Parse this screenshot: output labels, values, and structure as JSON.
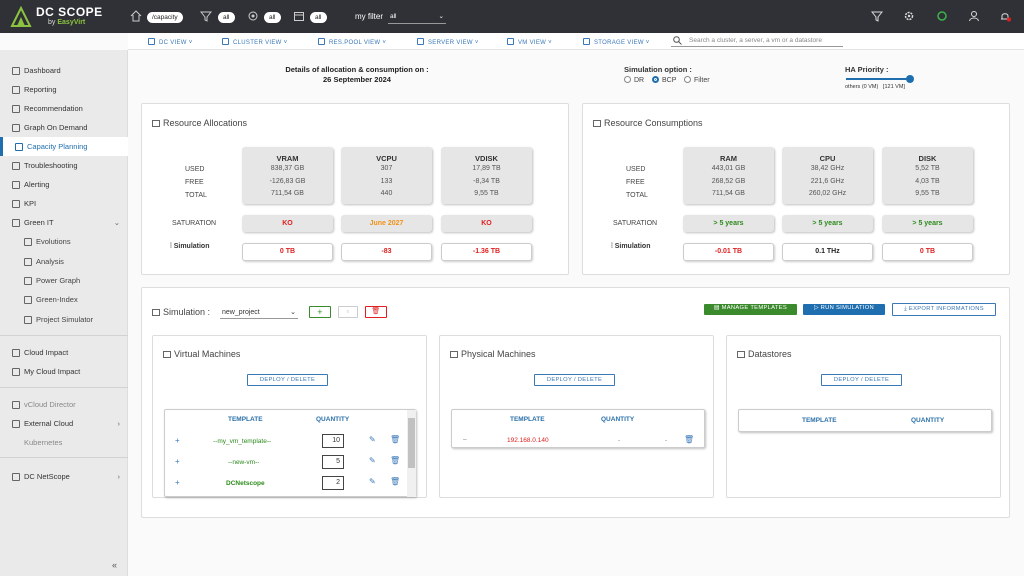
{
  "app": {
    "brand": "DC SCOPE",
    "brand_by": "by",
    "brand_sub": "EasyVirt"
  },
  "topbar": {
    "path": "/capacity",
    "filters": [
      "all",
      "all",
      "all"
    ],
    "my_filter_label": "my filter",
    "my_filter_value": "all"
  },
  "nav": [
    {
      "label": "DC VIEW ˅"
    },
    {
      "label": "CLUSTER VIEW ˅"
    },
    {
      "label": "RES.POOL VIEW ˅"
    },
    {
      "label": "SERVER VIEW ˅"
    },
    {
      "label": "VM VIEW ˅"
    },
    {
      "label": "STORAGE VIEW ˅"
    }
  ],
  "search": {
    "placeholder": "Search a cluster, a server, a vm or a datastore"
  },
  "sidebar": [
    {
      "label": "Dashboard"
    },
    {
      "label": "Reporting"
    },
    {
      "label": "Recommendation"
    },
    {
      "label": "Graph On Demand"
    },
    {
      "label": "Capacity Planning"
    },
    {
      "label": "Troubleshooting"
    },
    {
      "label": "Alerting"
    },
    {
      "label": "KPI"
    },
    {
      "label": "Green IT"
    },
    {
      "label": "Evolutions"
    },
    {
      "label": "Analysis"
    },
    {
      "label": "Power Graph"
    },
    {
      "label": "Green-Index"
    },
    {
      "label": "Project Simulator"
    },
    {
      "label": "Cloud Impact"
    },
    {
      "label": "My Cloud Impact"
    },
    {
      "label": "vCloud Director"
    },
    {
      "label": "External Cloud"
    },
    {
      "label": "Kubernetes"
    },
    {
      "label": "DC NetScope"
    }
  ],
  "header": {
    "details_line1": "Details of allocation & consumption on :",
    "details_date": "26 September 2024",
    "sim_option_label": "Simulation option :",
    "options": [
      "DR",
      "BCP",
      "Filter"
    ],
    "selected_option": "BCP",
    "ha_label": "HA Priority :",
    "ha_min": "others (0 VM)",
    "ha_max": "[121 VM]",
    "ha_level": 1.0
  },
  "row_labels": {
    "used": "USED",
    "free": "FREE",
    "total": "TOTAL",
    "saturation": "SATURATION",
    "simulation": "Simulation"
  },
  "allocations": {
    "title": "Resource Allocations",
    "metrics": [
      {
        "name": "VRAM",
        "used": "838,37 GB",
        "free": "-126,83 GB",
        "total": "711,54 GB",
        "saturation": "KO",
        "sat_color": "red",
        "simulation": "0 TB",
        "sim_color": "red"
      },
      {
        "name": "VCPU",
        "used": "307",
        "free": "133",
        "total": "440",
        "saturation": "June 2027",
        "sat_color": "orange",
        "simulation": "-83",
        "sim_color": "red"
      },
      {
        "name": "VDISK",
        "used": "17,89 TB",
        "free": "-8,34 TB",
        "total": "9,55 TB",
        "saturation": "KO",
        "sat_color": "red",
        "simulation": "-1.36 TB",
        "sim_color": "red"
      }
    ]
  },
  "consumptions": {
    "title": "Resource Consumptions",
    "metrics": [
      {
        "name": "RAM",
        "used": "443,01 GB",
        "free": "268,52 GB",
        "total": "711,54 GB",
        "saturation": "> 5 years",
        "sat_color": "green",
        "simulation": "-0.01 TB",
        "sim_color": "red"
      },
      {
        "name": "CPU",
        "used": "38,42 GHz",
        "free": "221,6 GHz",
        "total": "260,02 GHz",
        "saturation": "> 5 years",
        "sat_color": "green",
        "simulation": "0.1 THz",
        "sim_color": "dark"
      },
      {
        "name": "DISK",
        "used": "5,52 TB",
        "free": "4,03 TB",
        "total": "9,55 TB",
        "saturation": "> 5 years",
        "sat_color": "green",
        "simulation": "0 TB",
        "sim_color": "red"
      }
    ]
  },
  "simulation": {
    "label": "Simulation :",
    "project": "new_project",
    "manage_templates": "MANAGE TEMPLATES",
    "run": "RUN SIMULATION",
    "export": "EXPORT INFORMATIONS"
  },
  "vm": {
    "title": "Virtual Machines",
    "deploy": "DEPLOY / DELETE",
    "col_template": "TEMPLATE",
    "col_quantity": "QUANTITY",
    "rows": [
      {
        "name": "--my_vm_template--",
        "qty": "10"
      },
      {
        "name": "--new-vm--",
        "qty": "5"
      },
      {
        "name": "DCNetscope",
        "qty": "2"
      }
    ]
  },
  "pm": {
    "title": "Physical Machines",
    "deploy": "DEPLOY / DELETE",
    "col_template": "TEMPLATE",
    "col_quantity": "QUANTITY",
    "rows": [
      {
        "dash": "–",
        "name": "192.168.0.140",
        "qty": "-",
        "extra": "-"
      }
    ]
  },
  "ds": {
    "title": "Datastores",
    "deploy": "DEPLOY / DELETE",
    "col_template": "TEMPLATE",
    "col_quantity": "QUANTITY"
  },
  "colors": {
    "topbar": "#2f3136",
    "accent": "#1f6fb0",
    "green_btn": "#3c8a2e",
    "run_btn": "#1f6fb0",
    "danger": "#e02020"
  }
}
